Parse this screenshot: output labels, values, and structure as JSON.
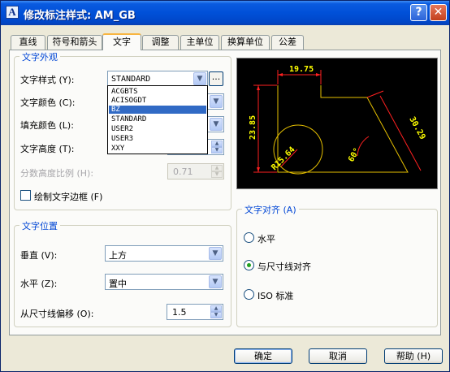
{
  "window": {
    "title": "修改标注样式: AM_GB",
    "help_glyph": "?",
    "close_glyph": "✕",
    "app_icon": "autocad-dimension-icon"
  },
  "tabs": [
    "直线",
    "符号和箭头",
    "文字",
    "调整",
    "主单位",
    "换算单位",
    "公差"
  ],
  "active_tab": "文字",
  "text_appearance": {
    "legend": "文字外观",
    "style_label": "文字样式 (Y):",
    "style_value": "STANDARD",
    "style_options": [
      "ACGBTS",
      "ACISOGDT",
      "BZ",
      "STANDARD",
      "USER2",
      "USER3",
      "XXY"
    ],
    "style_highlighted": "BZ",
    "browse_button": "...",
    "color_label": "文字颜色 (C):",
    "fill_label": "填充颜色 (L):",
    "height_label": "文字高度 (T):",
    "fraction_label": "分数高度比例 (H):",
    "fraction_value": "0.71",
    "frame_label": "绘制文字边框 (F)",
    "frame_checked": false
  },
  "text_placement": {
    "legend": "文字位置",
    "vertical_label": "垂直 (V):",
    "vertical_value": "上方",
    "horizontal_label": "水平 (Z):",
    "horizontal_value": "置中",
    "offset_label": "从尺寸线偏移 (O):",
    "offset_value": "1.5"
  },
  "text_alignment": {
    "legend": "文字对齐 (A)",
    "options": [
      "水平",
      "与尺寸线对齐",
      "ISO 标准"
    ],
    "selected": "与尺寸线对齐"
  },
  "preview": {
    "dim_top": "19.75",
    "dim_left": "23.85",
    "dim_radius": "R15.64",
    "dim_angle": "60°",
    "dim_diag": "30.29",
    "colors": {
      "geometry": "#e6c000",
      "dimension": "#ff2020",
      "text": "#ffff00"
    }
  },
  "buttons": {
    "ok": "确定",
    "cancel": "取消",
    "help": "帮助 (H)"
  }
}
